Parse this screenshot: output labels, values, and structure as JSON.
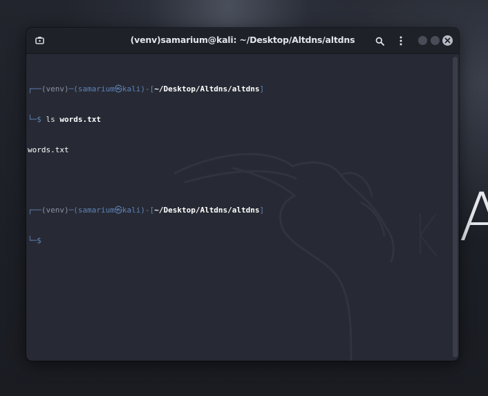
{
  "window": {
    "title": "(venv)samarium@kali: ~/Desktop/Altdns/altdns"
  },
  "titlebar_icons": {
    "left": "terminal-tab-icon",
    "search": "search-icon",
    "menu": "kebab-menu-icon",
    "close": "close-icon"
  },
  "terminal": {
    "prompt1": {
      "frame_top": "┌──",
      "venv": "(venv)",
      "dash": "─",
      "user_host": "(samarium㉿kali)",
      "bracket_open": "-[",
      "path": "~/Desktop/Altdns/altdns",
      "bracket_close": "]",
      "frame_bottom": "└─",
      "symbol": "$",
      "command": "ls",
      "argument": "words.txt"
    },
    "output": "words.txt",
    "prompt2": {
      "frame_top": "┌──",
      "venv": "(venv)",
      "dash": "─",
      "user_host": "(samarium㉿kali)",
      "bracket_open": "-[",
      "path": "~/Desktop/Altdns/altdns",
      "bracket_close": "]",
      "frame_bottom": "└─",
      "symbol": "$"
    }
  },
  "wallpaper": {
    "letter": "A"
  },
  "colors": {
    "terminal_bg": "#272a34",
    "titlebar_bg": "#1f2129",
    "prompt_frame": "#5f82b8",
    "text": "#ffffff"
  }
}
